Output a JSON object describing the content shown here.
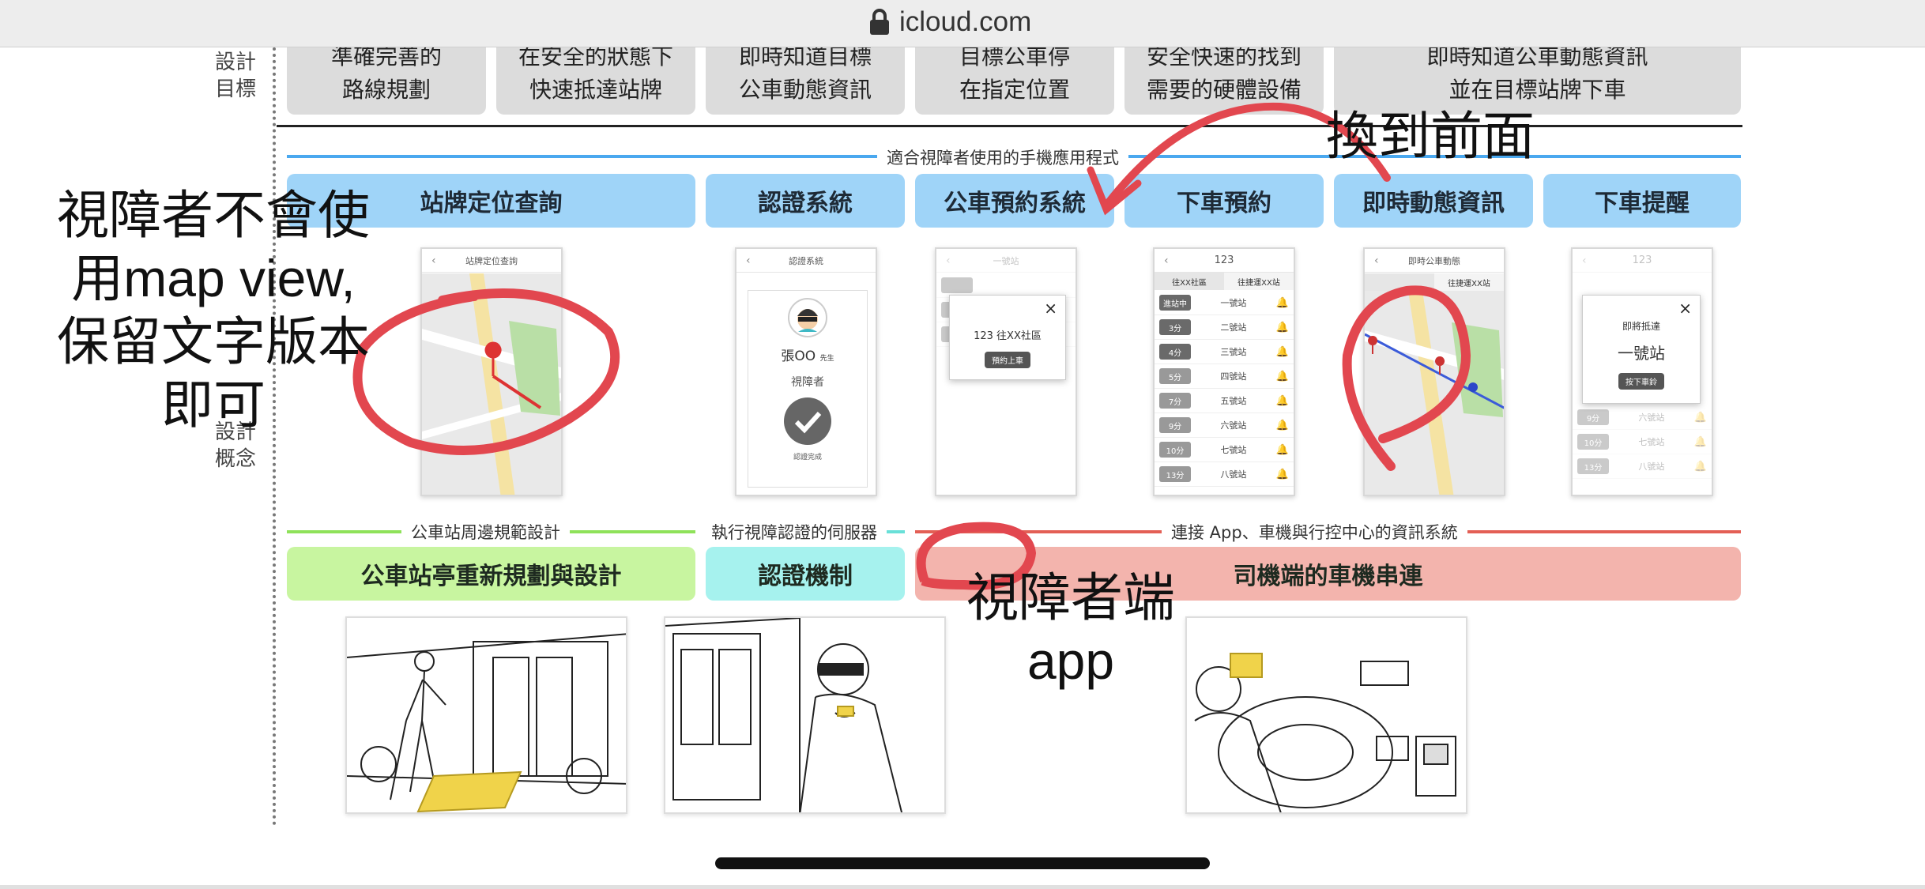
{
  "browser": {
    "url": "icloud.com"
  },
  "labels": {
    "goals_label": "設計\n目標",
    "concept_label": "設計\n概念"
  },
  "goals": [
    "準確完善的\n路線規劃",
    "在安全的狀態下\n快速抵達站牌",
    "即時知道目標\n公車動態資訊",
    "目標公車停\n在指定位置",
    "安全快速的找到\n需要的硬體設備",
    "即時知道公車動態資訊\n並在目標站牌下車"
  ],
  "app_section_title": "適合視障者使用的手機應用程式",
  "features": [
    "站牌定位查詢",
    "認證系統",
    "公車預約系統",
    "下車預約",
    "即時動態資訊",
    "下車提醒"
  ],
  "phones": {
    "locate": {
      "title": "站牌定位查詢"
    },
    "auth": {
      "title": "認證系統",
      "name": "張OO",
      "honorific": "先生",
      "role": "視障者",
      "status": "認證完成"
    },
    "reserve": {
      "title": "一號站",
      "route_text": "123 往XX社區",
      "button": "預約上車"
    },
    "alight": {
      "title": "123",
      "tabs": [
        "往XX社區",
        "往捷運XX站"
      ],
      "rows": [
        {
          "time": "進站中",
          "stop": "一號站"
        },
        {
          "time": "3分",
          "stop": "二號站"
        },
        {
          "time": "4分",
          "stop": "三號站"
        },
        {
          "time": "5分",
          "stop": "四號站"
        },
        {
          "time": "7分",
          "stop": "五號站"
        },
        {
          "time": "9分",
          "stop": "六號站"
        },
        {
          "time": "10分",
          "stop": "七號站"
        },
        {
          "time": "13分",
          "stop": "八號站"
        }
      ]
    },
    "realtime": {
      "title": "即時公車動態",
      "tab": "往捷運XX站"
    },
    "remind": {
      "title": "123",
      "modal_line1": "即將抵達",
      "modal_line2": "一號站",
      "button": "按下車鈴",
      "rows": [
        {
          "time": "9分",
          "stop": "六號站"
        },
        {
          "time": "10分",
          "stop": "七號站"
        },
        {
          "time": "13分",
          "stop": "八號站"
        }
      ]
    }
  },
  "sections": {
    "stop": "公車站周邊規範設計",
    "server": "執行視障認證的伺服器",
    "link": "連接 App、車機與行控中心的資訊系統"
  },
  "systems": [
    "公車站亭重新規劃與設計",
    "認證機制",
    "司機端的車機串連"
  ],
  "annotations": {
    "left": "視障者不會使\n用map view,\n保留文字版本\n即可",
    "top_right": "換到前面",
    "bottom": "視障者端\napp"
  },
  "colors": {
    "feature_blue": "#9fd4f8",
    "system_green": "#c8f5a0",
    "system_cyan": "#a6f2ee",
    "system_red": "#f3b4ad",
    "ink_red": "#e2474f"
  }
}
